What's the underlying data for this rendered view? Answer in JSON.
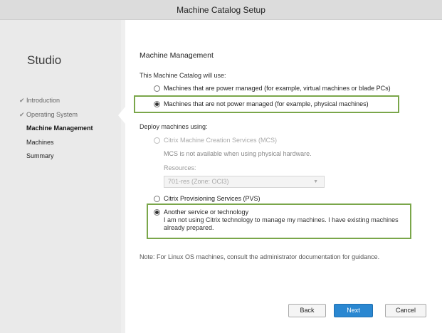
{
  "window": {
    "title": "Machine Catalog Setup"
  },
  "sidebar": {
    "brand": "Studio",
    "steps": [
      {
        "label": "Introduction",
        "state": "done"
      },
      {
        "label": "Operating System",
        "state": "done"
      },
      {
        "label": "Machine Management",
        "state": "active"
      },
      {
        "label": "Machines",
        "state": "pending"
      },
      {
        "label": "Summary",
        "state": "pending"
      }
    ],
    "check_glyph": "✔"
  },
  "main": {
    "heading": "Machine Management",
    "uses_label": "This Machine Catalog will use:",
    "power_options": [
      {
        "label": "Machines that are power managed (for example, virtual machines or blade PCs)",
        "selected": false
      },
      {
        "label": "Machines that are not power managed (for example, physical machines)",
        "selected": true
      }
    ],
    "deploy_label": "Deploy machines using:",
    "deploy_options": [
      {
        "label": "Citrix Machine Creation Services (MCS)",
        "selected": false,
        "disabled": true
      },
      {
        "label": "Citrix Provisioning Services (PVS)",
        "selected": false,
        "disabled": false
      },
      {
        "label": "Another service or technology",
        "selected": true,
        "disabled": false,
        "description": "I am not using Citrix technology to manage my machines. I have existing machines already prepared."
      }
    ],
    "mcs_unavailable": "MCS is not available when using physical hardware.",
    "resources_label": "Resources:",
    "resources_value": "701-res (Zone: OCI3)",
    "note": "Note: For Linux OS machines, consult the administrator documentation for guidance."
  },
  "buttons": {
    "back": "Back",
    "next": "Next",
    "cancel": "Cancel"
  },
  "colors": {
    "highlight": "#7aa64a",
    "primary_button": "#2a87d1"
  }
}
